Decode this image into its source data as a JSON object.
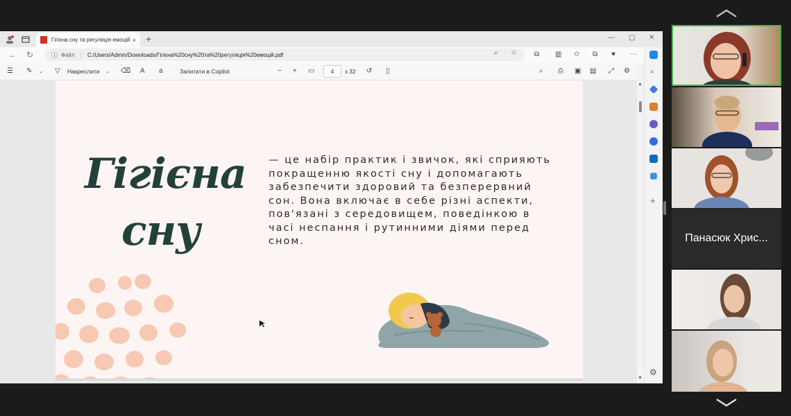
{
  "browser": {
    "tab_title": "Гігієна сну та регуляція емоцій.",
    "tab_close": "×",
    "new_tab": "+",
    "url_label": "Файл",
    "url": "C:/Users/Admin/Downloads/Гігієна%20сну%20та%20регуляція%20емоцій.pdf"
  },
  "pdf_toolbar": {
    "draw_label": "Накреслити",
    "copilot_label": "Запитати в Copilot",
    "zoom_out": "−",
    "zoom_in": "+",
    "page_current": "4",
    "page_total": "з 32"
  },
  "slide": {
    "title_line1": "Гігієна",
    "title_line2": "сну",
    "body": "— це набір практик і звичок, які сприяють покращенню якості сну і допомагають забезпечити здоровий та безперервний сон. Вона включає в себе різні аспекти, пов'язані з середовищем, поведінкою в часі неспання і рутинними діями перед сном."
  },
  "colors": {
    "title": "#23413a",
    "page_bg": "#fcf5f3",
    "dots": "#f7c9b3",
    "blanket": "#8fa5a8",
    "active_border": "#4caf50"
  },
  "participants": {
    "name_tile": "Панасюк Хрис..."
  }
}
